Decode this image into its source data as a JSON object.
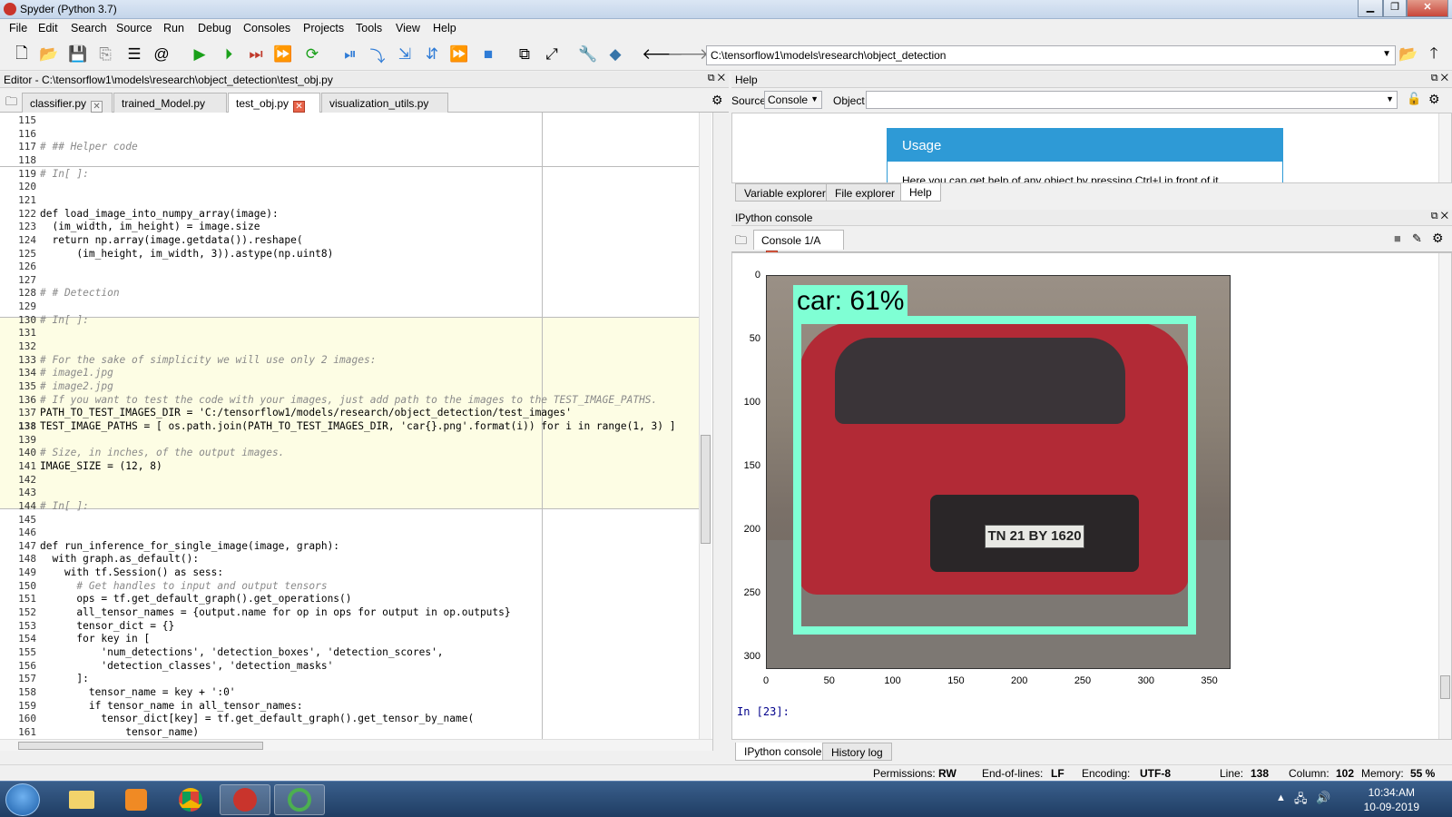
{
  "window": {
    "title": "Spyder (Python 3.7)"
  },
  "menu": [
    "File",
    "Edit",
    "Search",
    "Source",
    "Run",
    "Debug",
    "Consoles",
    "Projects",
    "Tools",
    "View",
    "Help"
  ],
  "toolbar": {
    "path": "C:\\tensorflow1\\models\\research\\object_detection"
  },
  "editor": {
    "header": "Editor - C:\\tensorflow1\\models\\research\\object_detection\\test_obj.py",
    "tabs": [
      {
        "label": "classifier.py",
        "active": false
      },
      {
        "label": "trained_Model.py",
        "active": false
      },
      {
        "label": "test_obj.py",
        "active": true
      },
      {
        "label": "visualization_utils.py",
        "active": false
      }
    ],
    "lines": [
      {
        "n": "115",
        "t": ""
      },
      {
        "n": "116",
        "t": ""
      },
      {
        "n": "117",
        "t": "# ## Helper code"
      },
      {
        "n": "118",
        "t": ""
      },
      {
        "n": "119",
        "t": "# In[ ]:"
      },
      {
        "n": "120",
        "t": ""
      },
      {
        "n": "121",
        "t": ""
      },
      {
        "n": "122",
        "t": "def load_image_into_numpy_array(image):"
      },
      {
        "n": "123",
        "t": "  (im_width, im_height) = image.size"
      },
      {
        "n": "124",
        "t": "  return np.array(image.getdata()).reshape("
      },
      {
        "n": "125",
        "t": "      (im_height, im_width, 3)).astype(np.uint8)"
      },
      {
        "n": "126",
        "t": ""
      },
      {
        "n": "127",
        "t": ""
      },
      {
        "n": "128",
        "t": "# # Detection"
      },
      {
        "n": "129",
        "t": ""
      },
      {
        "n": "130",
        "t": "# In[ ]:"
      },
      {
        "n": "131",
        "t": ""
      },
      {
        "n": "132",
        "t": ""
      },
      {
        "n": "133",
        "t": "# For the sake of simplicity we will use only 2 images:"
      },
      {
        "n": "134",
        "t": "# image1.jpg"
      },
      {
        "n": "135",
        "t": "# image2.jpg"
      },
      {
        "n": "136",
        "t": "# If you want to test the code with your images, just add path to the images to the TEST_IMAGE_PATHS."
      },
      {
        "n": "137",
        "t": "PATH_TO_TEST_IMAGES_DIR = 'C:/tensorflow1/models/research/object_detection/test_images'"
      },
      {
        "n": "138",
        "t": "TEST_IMAGE_PATHS = [ os.path.join(PATH_TO_TEST_IMAGES_DIR, 'car{}.png'.format(i)) for i in range(1, 3) ]"
      },
      {
        "n": "139",
        "t": ""
      },
      {
        "n": "140",
        "t": "# Size, in inches, of the output images."
      },
      {
        "n": "141",
        "t": "IMAGE_SIZE = (12, 8)"
      },
      {
        "n": "142",
        "t": ""
      },
      {
        "n": "143",
        "t": ""
      },
      {
        "n": "144",
        "t": "# In[ ]:"
      },
      {
        "n": "145",
        "t": ""
      },
      {
        "n": "146",
        "t": ""
      },
      {
        "n": "147",
        "t": "def run_inference_for_single_image(image, graph):"
      },
      {
        "n": "148",
        "t": "  with graph.as_default():"
      },
      {
        "n": "149",
        "t": "    with tf.Session() as sess:"
      },
      {
        "n": "150",
        "t": "      # Get handles to input and output tensors"
      },
      {
        "n": "151",
        "t": "      ops = tf.get_default_graph().get_operations()"
      },
      {
        "n": "152",
        "t": "      all_tensor_names = {output.name for op in ops for output in op.outputs}"
      },
      {
        "n": "153",
        "t": "      tensor_dict = {}"
      },
      {
        "n": "154",
        "t": "      for key in ["
      },
      {
        "n": "155",
        "t": "          'num_detections', 'detection_boxes', 'detection_scores',"
      },
      {
        "n": "156",
        "t": "          'detection_classes', 'detection_masks'"
      },
      {
        "n": "157",
        "t": "      ]:"
      },
      {
        "n": "158",
        "t": "        tensor_name = key + ':0'"
      },
      {
        "n": "159",
        "t": "        if tensor_name in all_tensor_names:"
      },
      {
        "n": "160",
        "t": "          tensor_dict[key] = tf.get_default_graph().get_tensor_by_name("
      },
      {
        "n": "161",
        "t": "              tensor_name)"
      }
    ]
  },
  "help": {
    "header": "Help",
    "source_label": "Source",
    "source_value": "Console",
    "object_label": "Object",
    "usage_title": "Usage",
    "usage_text": "Here you can get help of any object by pressing Ctrl+I in front of it",
    "bottom_tabs": [
      "Variable explorer",
      "File explorer",
      "Help"
    ]
  },
  "console": {
    "header": "IPython console",
    "tab": "Console 1/A",
    "prompt": "In [23]:",
    "bottom_tabs": [
      "IPython console",
      "History log"
    ],
    "detection_label": "car: 61%",
    "plate_text": "TN 21 BY 1620",
    "yticks": [
      "0",
      "50",
      "100",
      "150",
      "200",
      "250",
      "300"
    ],
    "xticks": [
      "0",
      "50",
      "100",
      "150",
      "200",
      "250",
      "300",
      "350"
    ]
  },
  "status": {
    "permissions_label": "Permissions:",
    "permissions": "RW",
    "eol_label": "End-of-lines:",
    "eol": "LF",
    "encoding_label": "Encoding:",
    "encoding": "UTF-8",
    "line_label": "Line:",
    "line": "138",
    "column_label": "Column:",
    "column": "102",
    "memory_label": "Memory:",
    "memory": "55 %"
  },
  "taskbar": {
    "time": "10:34:AM",
    "date": "10-09-2019"
  },
  "colors": {
    "accent": "#2e9ad6",
    "bbox": "#7fffd4",
    "cell_bg": "#fdfde4"
  }
}
